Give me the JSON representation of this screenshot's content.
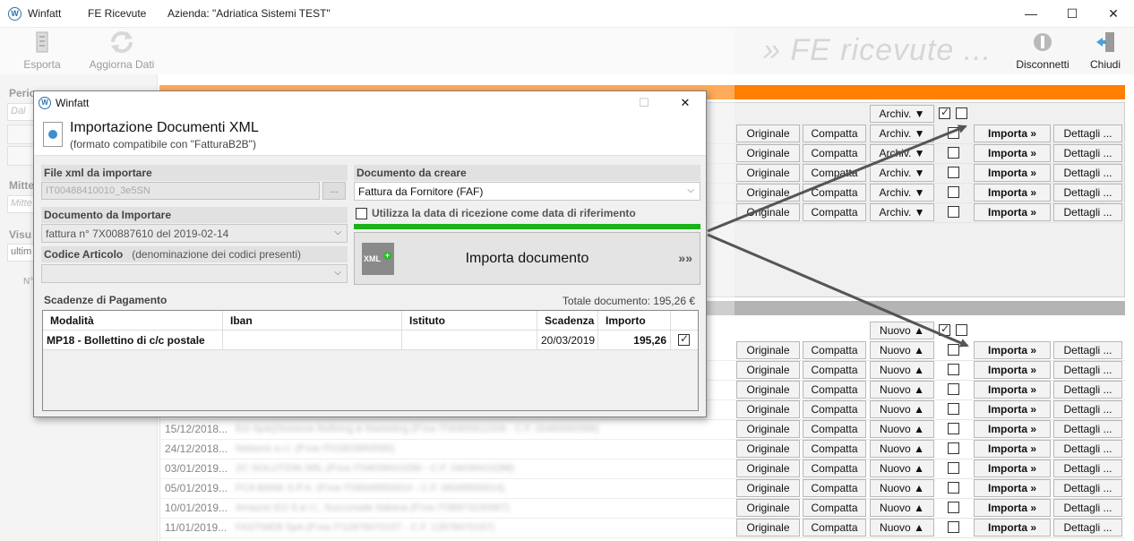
{
  "window": {
    "logo": "W",
    "app_title": "Winfatt",
    "section_title": "FE Ricevute",
    "company": "Azienda: \"Adriatica Sistemi TEST\"",
    "minimize": "—",
    "maximize": "☐",
    "close": "✕"
  },
  "toolbar": {
    "export_label": "Esporta",
    "refresh_label": "Aggiorna Dati",
    "disconnect_label": "Disconnetti",
    "close_label": "Chiudi",
    "big_title": "» FE ricevute ..."
  },
  "left_pane": {
    "period_label": "Perio",
    "date_placeholder": "Dal",
    "sender_label": "Mitte",
    "sender_placeholder": "Mitte",
    "view_label": "Visu",
    "view_value": "ultim",
    "count_label": "N°"
  },
  "top_grid": {
    "header": {
      "archive_label": "Archiv. ▼"
    },
    "rows": [
      {
        "original": "Originale",
        "compact": "Compatta",
        "action": "Archiv. ▼",
        "import": "Importa »",
        "details": "Dettagli ..."
      },
      {
        "original": "Originale",
        "compact": "Compatta",
        "action": "Archiv. ▼",
        "import": "Importa »",
        "details": "Dettagli ..."
      },
      {
        "original": "Originale",
        "compact": "Compatta",
        "action": "Archiv. ▼",
        "import": "Importa »",
        "details": "Dettagli ..."
      },
      {
        "original": "Originale",
        "compact": "Compatta",
        "action": "Archiv. ▼",
        "import": "Importa »",
        "details": "Dettagli ..."
      },
      {
        "original": "Originale",
        "compact": "Compatta",
        "action": "Archiv. ▼",
        "import": "Importa »",
        "details": "Dettagli ..."
      }
    ]
  },
  "bottom_grid": {
    "header": {
      "new_label": "Nuovo ▲"
    },
    "rows": [
      {
        "date": "",
        "desc": "",
        "original": "Originale",
        "compact": "Compatta",
        "action": "Nuovo ▲",
        "import": "Importa »",
        "details": "Dettagli ..."
      },
      {
        "date": "",
        "desc": "",
        "original": "Originale",
        "compact": "Compatta",
        "action": "Nuovo ▲",
        "import": "Importa »",
        "details": "Dettagli ..."
      },
      {
        "date": "",
        "desc": "",
        "original": "Originale",
        "compact": "Compatta",
        "action": "Nuovo ▲",
        "import": "Importa »",
        "details": "Dettagli ..."
      },
      {
        "date": "",
        "desc": "",
        "original": "Originale",
        "compact": "Compatta",
        "action": "Nuovo ▲",
        "import": "Importa »",
        "details": "Dettagli ..."
      },
      {
        "date": "15/12/2018...",
        "desc": "Eni SpA(Divisione Refining & Marketing (P.iva IT00905811006 - C.F. 00484960588)",
        "original": "Originale",
        "compact": "Compatta",
        "action": "Nuovo ▲",
        "import": "Importa »",
        "details": "Dettagli ..."
      },
      {
        "date": "24/12/2018...",
        "desc": "Netsons s.r.l. (P.iva IT01803850590)",
        "original": "Originale",
        "compact": "Compatta",
        "action": "Nuovo ▲",
        "import": "Importa »",
        "details": "Dettagli ..."
      },
      {
        "date": "03/01/2019...",
        "desc": "ZC SOLUTION SRL (P.iva IT04039410286 - C.F. 04039410286)",
        "original": "Originale",
        "compact": "Compatta",
        "action": "Nuovo ▲",
        "import": "Importa »",
        "details": "Dettagli ..."
      },
      {
        "date": "05/01/2019...",
        "desc": "FCA BANK S.P.A. (P.iva IT08349550014 - C.F. 08349550014)",
        "original": "Originale",
        "compact": "Compatta",
        "action": "Nuovo ▲",
        "import": "Importa »",
        "details": "Dettagli ..."
      },
      {
        "date": "10/01/2019...",
        "desc": "Amazon EU S.à r.l., Succursale Italiana (P.iva IT08973230967)",
        "original": "Originale",
        "compact": "Compatta",
        "action": "Nuovo ▲",
        "import": "Importa »",
        "details": "Dettagli ..."
      },
      {
        "date": "11/01/2019...",
        "desc": "FASTWEB SpA (P.iva IT12878470157 - C.F. 12878470157)",
        "original": "Originale",
        "compact": "Compatta",
        "action": "Nuovo ▲",
        "import": "Importa »",
        "details": "Dettagli ..."
      }
    ]
  },
  "dialog": {
    "logo": "W",
    "title": "Winfatt",
    "maximize": "☐",
    "close": "✕",
    "heading": "Importazione Documenti XML",
    "subheading": "(formato compatibile con \"FatturaB2B\")",
    "file_label": "File xml da importare",
    "file_value": "IT00488410010_3e5SN",
    "file_button": "...",
    "doc_import_label": "Documento da Importare",
    "doc_import_value": "fattura n° 7X00887610 del 2019-02-14",
    "article_label": "Codice Articolo",
    "article_hint": "(denominazione dei codici presenti)",
    "doc_create_label": "Documento da creare",
    "doc_create_value": "Fattura da Fornitore  (FAF)",
    "use_date_label": "Utilizza la data di ricezione come data di riferimento",
    "import_button": "Importa documento",
    "import_icon_text": "XML",
    "import_arrows": "»»",
    "payments_label": "Scadenze di Pagamento",
    "total_label": "Totale documento: 195,26 €",
    "payments_columns": [
      "Modalità",
      "Iban",
      "Istituto",
      "Scadenza",
      "Importo"
    ],
    "payments_rows": [
      {
        "mode": "MP18 - Bollettino di c/c postale",
        "iban": "",
        "bank": "",
        "due": "20/03/2019",
        "amount": "195,26",
        "checked": true
      }
    ]
  },
  "colors": {
    "orange": "#ff7f00",
    "green": "#19b319",
    "arrow": "#555555"
  }
}
